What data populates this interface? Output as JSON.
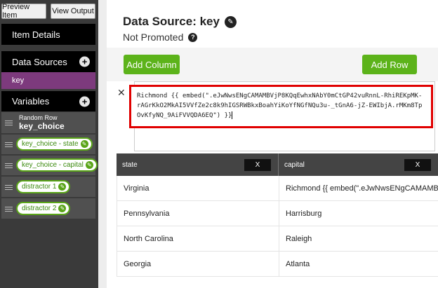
{
  "sidebar": {
    "preview_item": "Preview Item",
    "view_output": "View Output",
    "item_details": "Item Details",
    "data_sources": "Data Sources",
    "data_source_items": [
      "key"
    ],
    "variables": "Variables",
    "plus_glyph": "+",
    "random_row_label": "Random Row",
    "random_row_name": "key_choice",
    "variable_pills": [
      "key_choice - state",
      "key_choice - capital",
      "distractor 1",
      "distractor 2"
    ]
  },
  "main": {
    "title": "Data Source: key",
    "subtitle": "Not Promoted",
    "add_column": "Add Column",
    "add_row": "Add Row",
    "close_glyph": "✕",
    "formula": "Richmond {{ embed(\".eJwNwsENgCAMAMBVjP8KQqEwhxNAbY0mCtGP42vuRnnL-RhiREKpMK-rAGrKkO2MkAI5VVfZe2c8k9hIGSRWBkxBoahYiKoYfNGfNQu3u-_tGnA6-jZ-EWIbjA.rMKm8TpOvKfyNQ_9AiFVVQDA6EQ\") }}",
    "table": {
      "columns": [
        "state",
        "capital"
      ],
      "remove_label": "X",
      "rows": [
        [
          "Virginia",
          "Richmond {{ embed(\".eJwNwsENgCAMAMB"
        ],
        [
          "Pennsylvania",
          "Harrisburg"
        ],
        [
          "North Carolina",
          "Raleigh"
        ],
        [
          "Georgia",
          "Atlanta"
        ]
      ]
    }
  },
  "colors": {
    "accent_green": "#5cb31a",
    "selected_purple": "#7d3a7d",
    "highlight_red": "#e00000"
  }
}
